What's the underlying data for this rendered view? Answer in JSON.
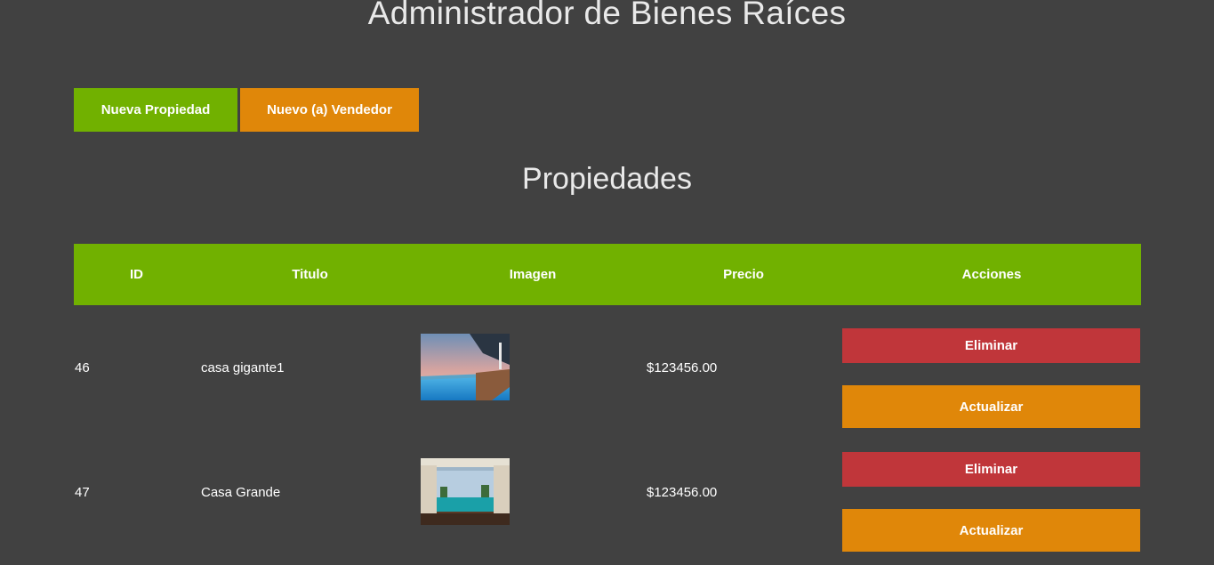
{
  "header": {
    "title": "Administrador de Bienes Raíces"
  },
  "actions": {
    "new_property_label": "Nueva Propiedad",
    "new_seller_label": "Nuevo (a) Vendedor"
  },
  "section": {
    "title": "Propiedades"
  },
  "table": {
    "columns": [
      "ID",
      "Titulo",
      "Imagen",
      "Precio",
      "Acciones"
    ],
    "rows": [
      {
        "id": "46",
        "title": "casa gigante1",
        "image_icon": "pool-photo",
        "price": "$123456.00",
        "delete_label": "Eliminar",
        "update_label": "Actualizar"
      },
      {
        "id": "47",
        "title": "Casa Grande",
        "image_icon": "cabana-photo",
        "price": "$123456.00",
        "delete_label": "Eliminar",
        "update_label": "Actualizar"
      }
    ]
  },
  "colors": {
    "background": "#414141",
    "green": "#71b100",
    "orange": "#e08709",
    "red": "#c0363a"
  }
}
